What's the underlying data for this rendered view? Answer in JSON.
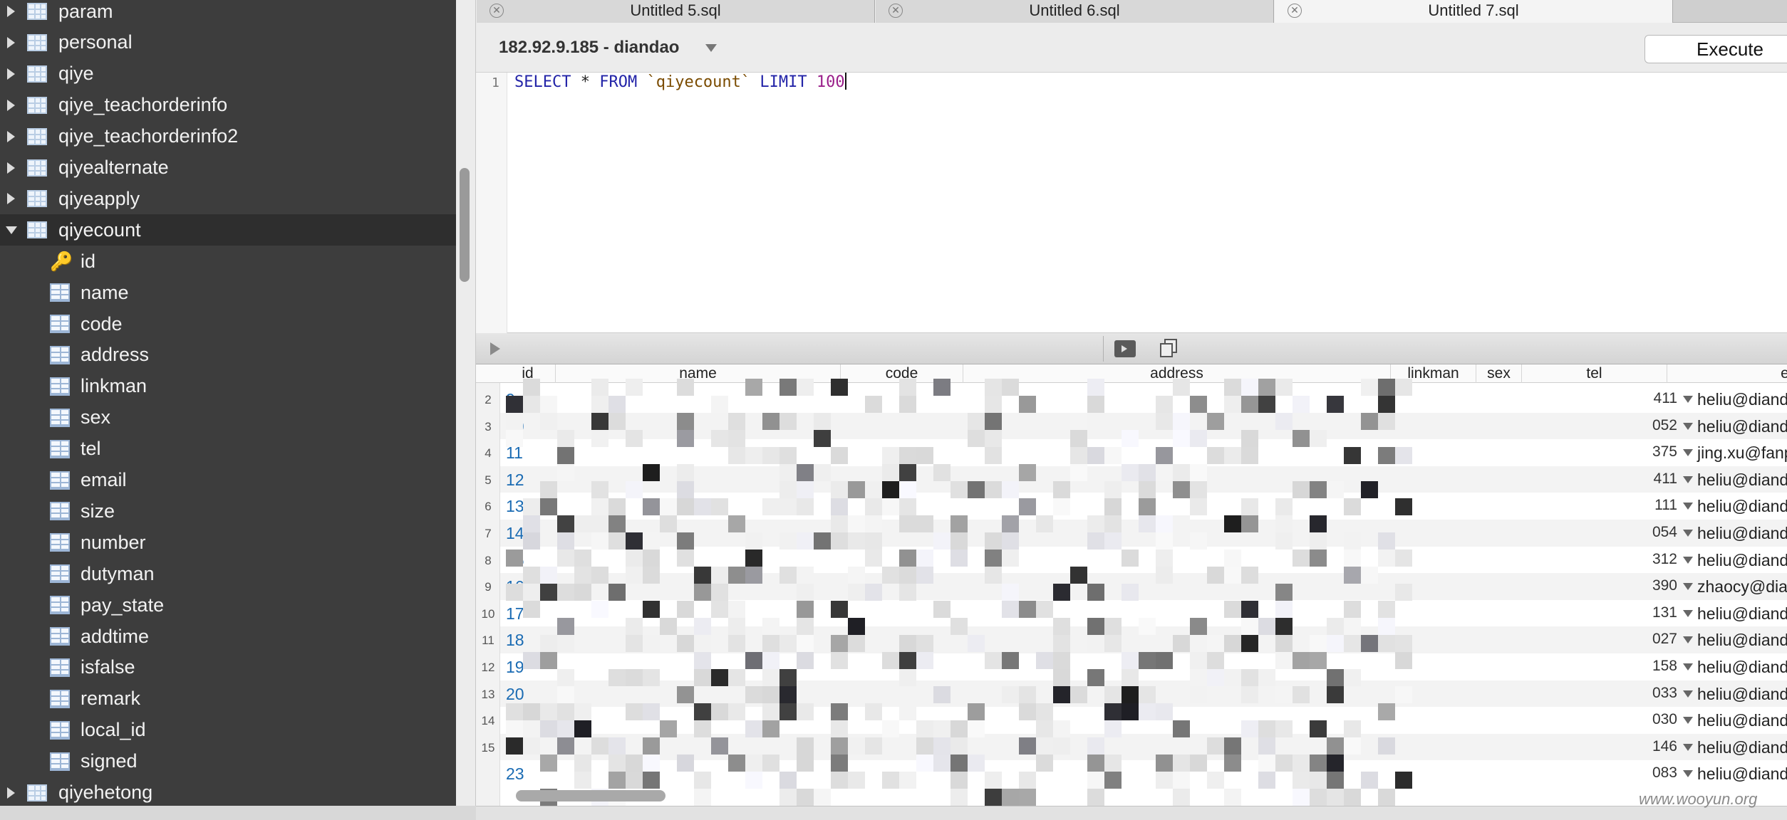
{
  "sidebar": {
    "tables_before": [
      {
        "label": "param"
      },
      {
        "label": "personal"
      },
      {
        "label": "qiye"
      },
      {
        "label": "qiye_teachorderinfo"
      },
      {
        "label": "qiye_teachorderinfo2"
      },
      {
        "label": "qiyealternate"
      },
      {
        "label": "qiyeapply"
      }
    ],
    "expanded_table": {
      "label": "qiyecount"
    },
    "columns": [
      {
        "label": "id",
        "icon": "key-icon"
      },
      {
        "label": "name"
      },
      {
        "label": "code"
      },
      {
        "label": "address"
      },
      {
        "label": "linkman"
      },
      {
        "label": "sex"
      },
      {
        "label": "tel"
      },
      {
        "label": "email"
      },
      {
        "label": "size"
      },
      {
        "label": "number"
      },
      {
        "label": "dutyman"
      },
      {
        "label": "pay_state"
      },
      {
        "label": "addtime"
      },
      {
        "label": "isfalse"
      },
      {
        "label": "remark"
      },
      {
        "label": "local_id"
      },
      {
        "label": "signed"
      }
    ],
    "tables_after": [
      {
        "label": "qiyehetong"
      }
    ]
  },
  "tabs": [
    {
      "label": "Untitled 5.sql",
      "active": false
    },
    {
      "label": "Untitled 6.sql",
      "active": false
    },
    {
      "label": "Untitled 7.sql",
      "active": true
    }
  ],
  "connection": {
    "label": "182.92.9.185 - diandao"
  },
  "toolbar": {
    "execute_label": "Execute"
  },
  "editor": {
    "line_number": "1",
    "tokens": {
      "select": "SELECT",
      "star": " * ",
      "from": "FROM",
      "table": " `qiyecount` ",
      "limit": "LIMIT",
      "count": " 100"
    }
  },
  "results": {
    "columns": [
      "id",
      "name",
      "code",
      "address",
      "linkman",
      "sex",
      "tel",
      "ema"
    ],
    "rows": [
      {
        "rownum": "2",
        "id": "9",
        "tel": "411",
        "email": "heliu@diandao"
      },
      {
        "rownum": "3",
        "id": "10",
        "tel": "052",
        "email": "heliu@diandao"
      },
      {
        "rownum": "4",
        "id": "11",
        "tel": "375",
        "email": "jing.xu@fanplu"
      },
      {
        "rownum": "5",
        "id": "12",
        "tel": "411",
        "email": "heliu@diandao"
      },
      {
        "rownum": "6",
        "id": "13",
        "tel": "111",
        "email": "heliu@diandao"
      },
      {
        "rownum": "7",
        "id": "14",
        "tel": "054",
        "email": "heliu@diandao"
      },
      {
        "rownum": "8",
        "id": "15",
        "tel": "312",
        "email": "heliu@diandao"
      },
      {
        "rownum": "9",
        "id": "16",
        "tel": "390",
        "email": "zhaocy@diand"
      },
      {
        "rownum": "10",
        "id": "17",
        "tel": "131",
        "email": "heliu@diandao"
      },
      {
        "rownum": "11",
        "id": "18",
        "tel": "027",
        "email": "heliu@diandao"
      },
      {
        "rownum": "12",
        "id": "19",
        "tel": "158",
        "email": "heliu@diandao"
      },
      {
        "rownum": "13",
        "id": "20",
        "tel": "033",
        "email": "heliu@diandao"
      },
      {
        "rownum": "14",
        "id": "21",
        "tel": "030",
        "email": "heliu@diandao"
      },
      {
        "rownum": "15",
        "id": "22",
        "tel": "146",
        "email": "heliu@diandao"
      },
      {
        "rownum": "",
        "id": "23",
        "tel": "083",
        "email": "heliu@diandao"
      }
    ]
  },
  "watermark": "www.wooyun.org",
  "colors": {
    "sidebar_bg": "#3d3d3d",
    "id_text": "#1a6bb3",
    "sql_keyword": "#2324a8",
    "sql_identifier": "#7a4b00",
    "sql_number": "#9a1f8a"
  }
}
